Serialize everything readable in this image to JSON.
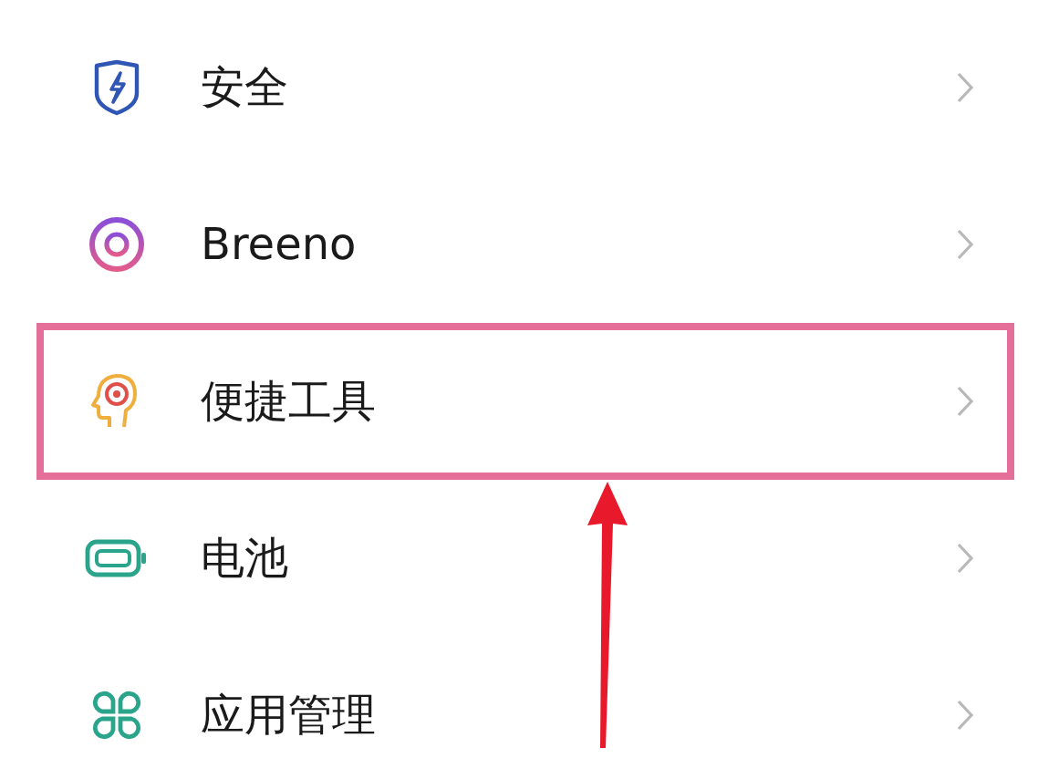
{
  "settings_items": [
    {
      "label": "安全",
      "highlighted": false
    },
    {
      "label": "Breeno",
      "highlighted": false
    },
    {
      "label": "便捷工具",
      "highlighted": true
    },
    {
      "label": "电池",
      "highlighted": false
    },
    {
      "label": "应用管理",
      "highlighted": false
    }
  ]
}
